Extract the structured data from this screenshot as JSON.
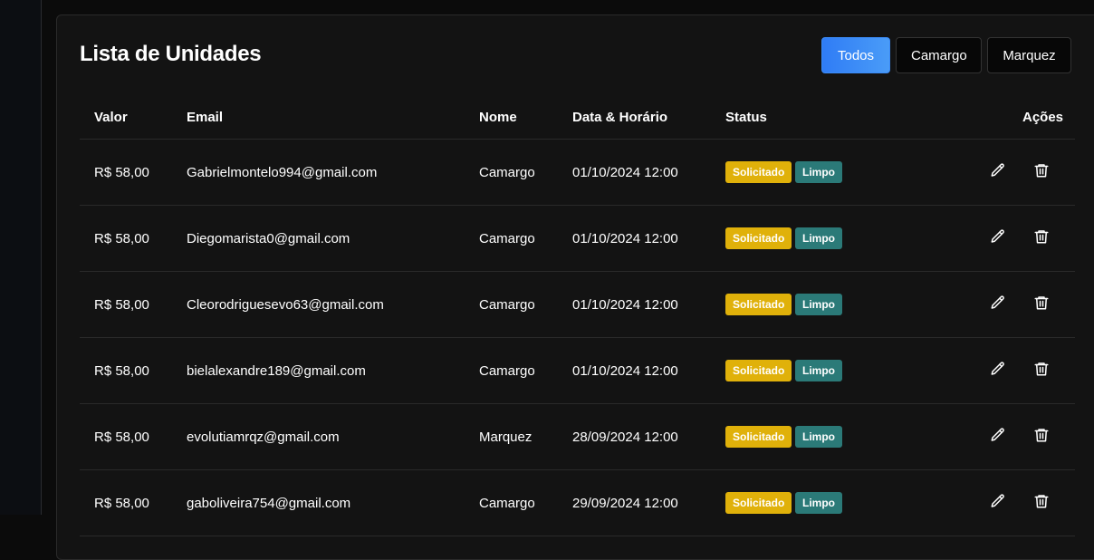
{
  "title": "Lista de Unidades",
  "filters": [
    {
      "label": "Todos",
      "active": true
    },
    {
      "label": "Camargo",
      "active": false
    },
    {
      "label": "Marquez",
      "active": false
    }
  ],
  "columns": {
    "valor": "Valor",
    "email": "Email",
    "nome": "Nome",
    "data": "Data & Horário",
    "status": "Status",
    "acoes": "Ações"
  },
  "rows": [
    {
      "valor": "R$ 58,00",
      "email": "Gabrielmontelo994@gmail.com",
      "nome": "Camargo",
      "data": "01/10/2024 12:00",
      "status": "Solicitado",
      "tipo": "Limpo"
    },
    {
      "valor": "R$ 58,00",
      "email": "Diegomarista0@gmail.com",
      "nome": "Camargo",
      "data": "01/10/2024 12:00",
      "status": "Solicitado",
      "tipo": "Limpo"
    },
    {
      "valor": "R$ 58,00",
      "email": "Cleorodriguesevo63@gmail.com",
      "nome": "Camargo",
      "data": "01/10/2024 12:00",
      "status": "Solicitado",
      "tipo": "Limpo"
    },
    {
      "valor": "R$ 58,00",
      "email": "bielalexandre189@gmail.com",
      "nome": "Camargo",
      "data": "01/10/2024 12:00",
      "status": "Solicitado",
      "tipo": "Limpo"
    },
    {
      "valor": "R$ 58,00",
      "email": "evolutiamrqz@gmail.com",
      "nome": "Marquez",
      "data": "28/09/2024 12:00",
      "status": "Solicitado",
      "tipo": "Limpo"
    },
    {
      "valor": "R$ 58,00",
      "email": "gaboliveira754@gmail.com",
      "nome": "Camargo",
      "data": "29/09/2024 12:00",
      "status": "Solicitado",
      "tipo": "Limpo"
    }
  ],
  "colors": {
    "accent": "#2f7cf6",
    "status_solicitado": "#e0b10a",
    "tipo_limpo": "#2b7a78"
  }
}
